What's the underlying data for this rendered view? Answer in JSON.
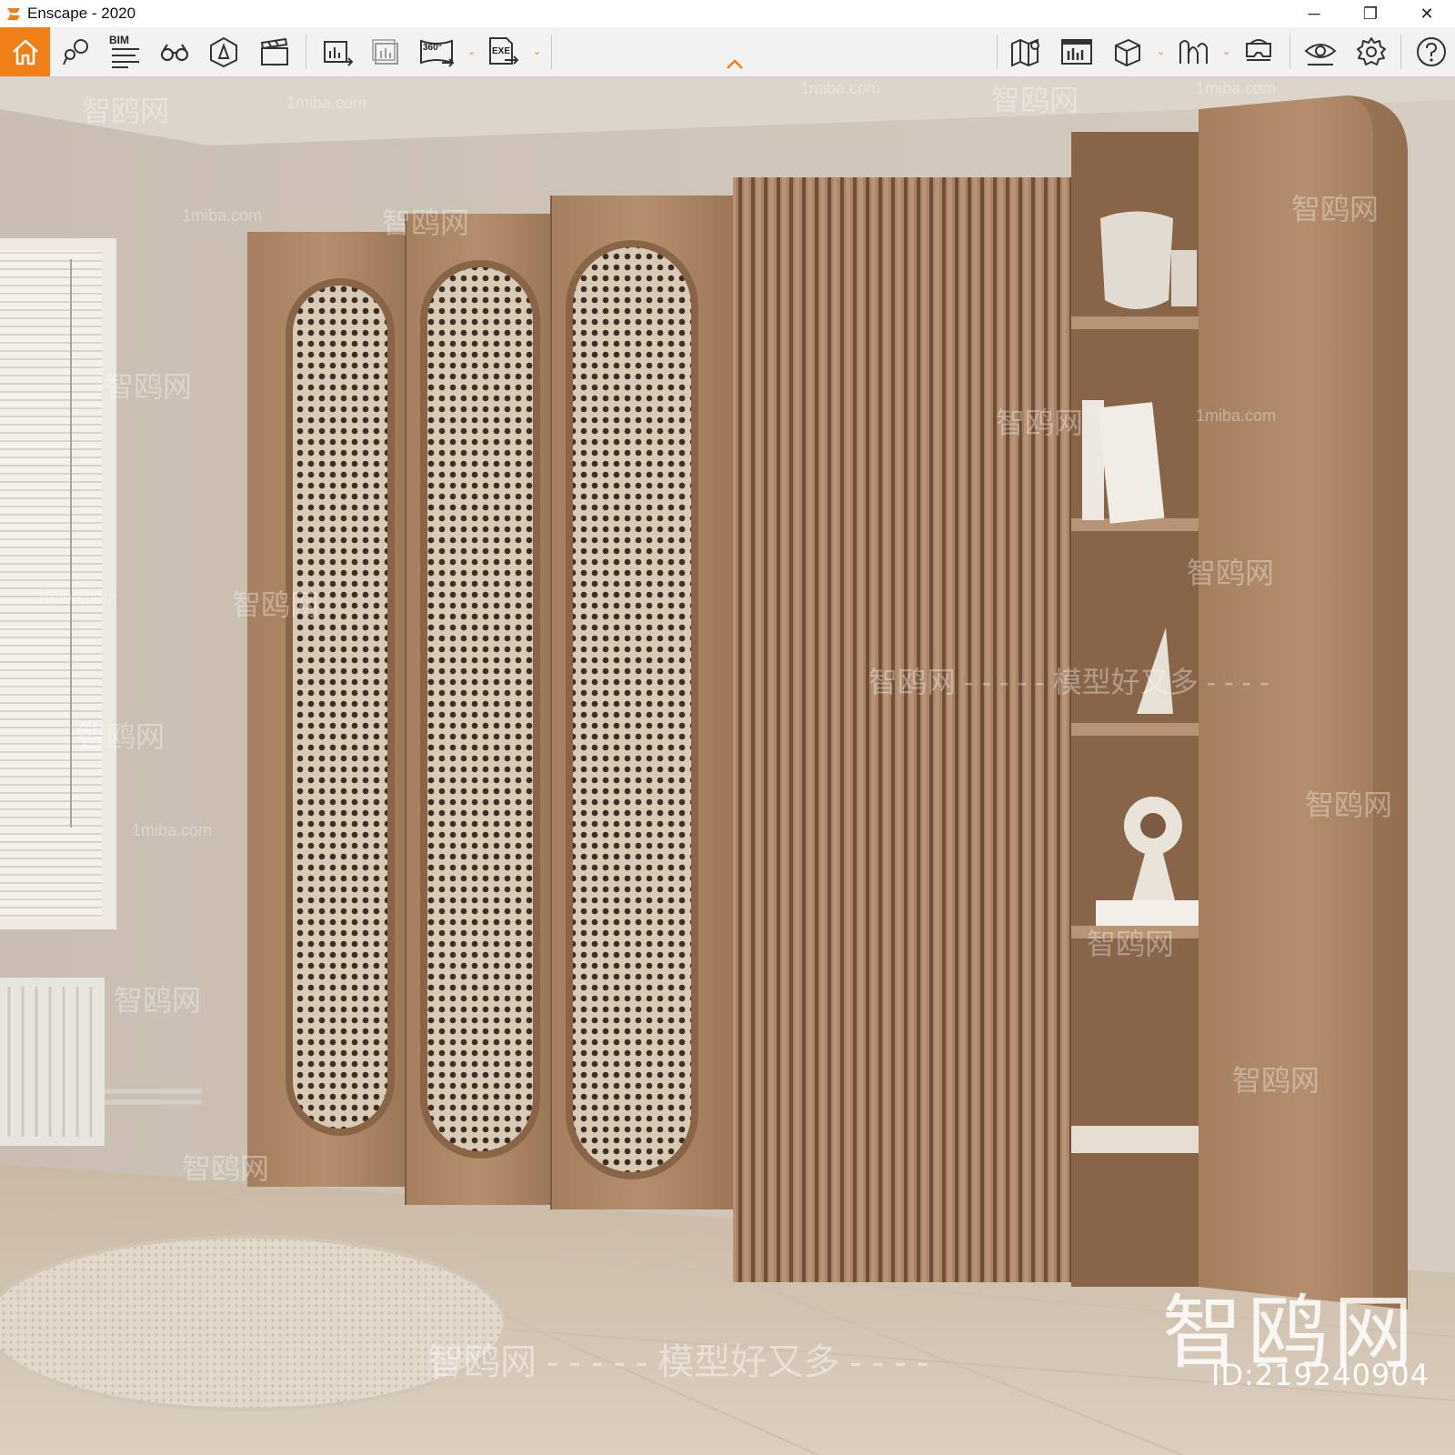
{
  "window": {
    "title": "Enscape - 2020",
    "controls": {
      "minimize": "─",
      "restore": "❐",
      "close": "✕"
    }
  },
  "toolbar": {
    "bim_label": "BIM",
    "panorama_label": "360°",
    "exe_label": "EXE",
    "accent_color": "#f07f18",
    "buttons": [
      "home-icon",
      "location-icon",
      "bim-icon",
      "binoculars-icon",
      "assets-icon",
      "video-editor-icon",
      "batch-render-icon",
      "render-image-icon",
      "panorama-icon",
      "export-exe-icon",
      "map-icon",
      "gallery-icon",
      "cube-icon",
      "sound-icon",
      "vr-headset-icon",
      "visibility-icon",
      "settings-icon",
      "help-icon"
    ]
  },
  "scene": {
    "watermark_text": "智鸥网",
    "watermark_site": "1miba.com",
    "watermark_slogan": "智鸥网 - - - - - 模型好又多 - - - -",
    "watermark_line_slogan": "智鸥网 - - - - - 模型好又多 - - - -",
    "big_logo": "智鸥网",
    "image_id": "ID:219240904"
  }
}
